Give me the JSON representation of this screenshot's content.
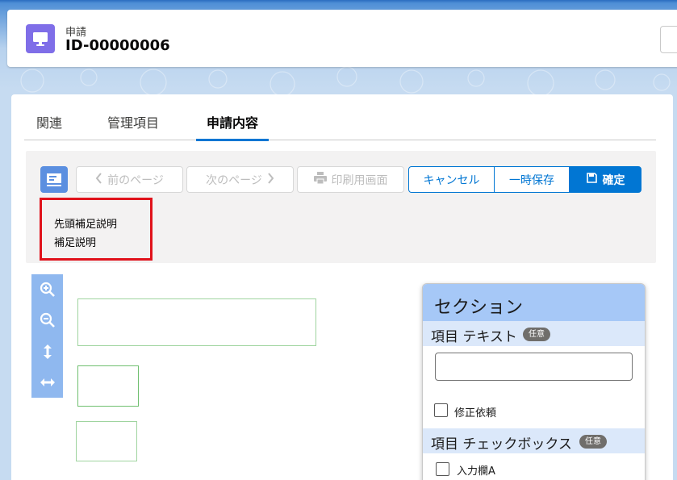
{
  "header": {
    "object_label": "申請",
    "record_name": "ID-00000006"
  },
  "tabs": [
    {
      "label": "関連"
    },
    {
      "label": "管理項目"
    },
    {
      "label": "申請内容"
    }
  ],
  "toolbar": {
    "prev_page": "前のページ",
    "next_page": "次のページ",
    "print_view": "印刷用画面",
    "cancel": "キャンセル",
    "temp_save": "一時保存",
    "confirm": "確定"
  },
  "description": {
    "lead": "先頭補足説明",
    "body": "補足説明"
  },
  "section": {
    "title": "セクション",
    "text_field_label": "項目 テキスト",
    "text_field_badge": "任意",
    "text_field_value": "",
    "revision_request_label": "修正依頼",
    "checkbox_field_label": "項目 チェックボックス",
    "checkbox_field_badge": "任意",
    "checkbox_option_label": "入力欄A"
  },
  "colors": {
    "brand_blue": "#0176d3",
    "header_icon": "#7f6ee8",
    "highlight_red": "#e0121b"
  }
}
